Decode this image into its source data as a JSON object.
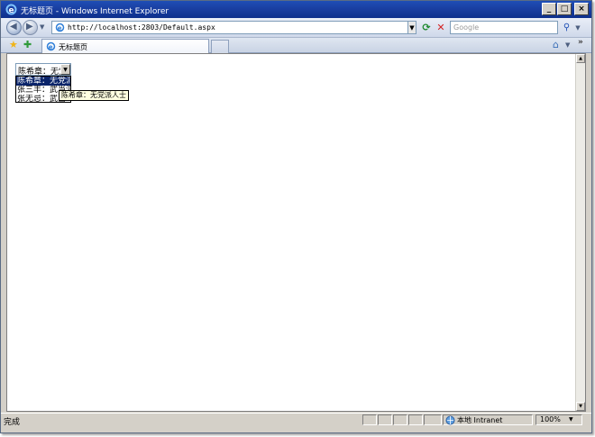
{
  "window": {
    "title": "无标题页 - Windows Internet Explorer",
    "buttons": {
      "minimize": "_",
      "maximize": "□",
      "close": "×"
    }
  },
  "toolbar": {
    "address": "http://localhost:2803/Default.aspx",
    "search_placeholder": "Google",
    "refresh_icon": "refresh-icon",
    "stop_icon": "stop-icon"
  },
  "tabs": [
    {
      "label": "无标题页",
      "icon": "ie-page-icon"
    }
  ],
  "page": {
    "select": {
      "value": "陈希章：无党",
      "options": [
        {
          "label": "陈希章：无党派",
          "selected": true
        },
        {
          "label": "张三丰：武当派",
          "selected": false
        },
        {
          "label": "张无忌：武当",
          "selected": false
        }
      ]
    },
    "tooltip": "陈希章：无党派人士"
  },
  "status": {
    "text": "完成",
    "zone": "本地 Intranet",
    "zoom": "100%"
  },
  "colors": {
    "titlebar": "#1a3fa2",
    "selected_option": "#0a246a",
    "tooltip_bg": "#ffffe1"
  }
}
